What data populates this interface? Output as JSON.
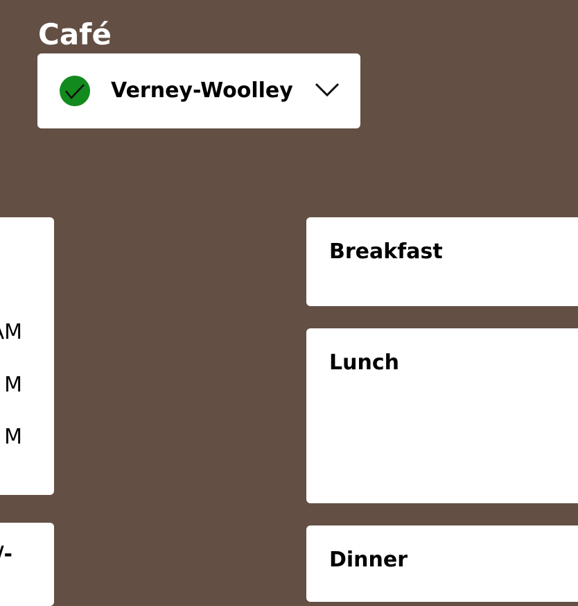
{
  "header": {
    "section_label": "Café"
  },
  "cafe_selector": {
    "selected": "Verney-Woolley",
    "status_icon": "check-circle-icon",
    "status_color": "#138a1e",
    "dropdown_icon": "chevron-down-icon"
  },
  "left_panel": {
    "hours": [
      "AM",
      "M",
      "M"
    ],
    "bottom_fragment": "/-"
  },
  "meals": [
    {
      "label": "Breakfast"
    },
    {
      "label": "Lunch"
    },
    {
      "label": "Dinner"
    }
  ],
  "colors": {
    "background": "#634f44",
    "card": "#ffffff",
    "accent_green": "#138a1e"
  }
}
